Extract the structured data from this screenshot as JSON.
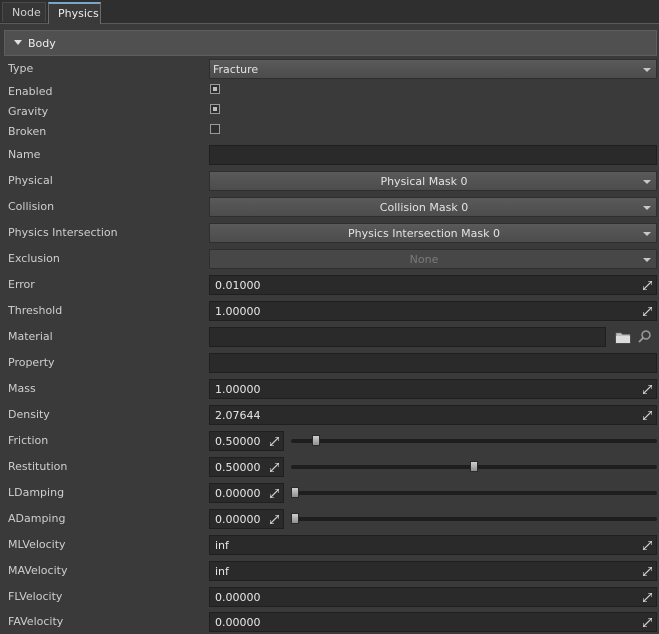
{
  "tabs": [
    {
      "label": "Node",
      "active": false
    },
    {
      "label": "Physics",
      "active": true
    }
  ],
  "section": {
    "title": "Body",
    "expanded": true
  },
  "rows": {
    "type": {
      "label": "Type",
      "value": "Fracture"
    },
    "enabled": {
      "label": "Enabled",
      "checked": true
    },
    "gravity": {
      "label": "Gravity",
      "checked": true
    },
    "broken": {
      "label": "Broken",
      "checked": false
    },
    "name": {
      "label": "Name",
      "value": ""
    },
    "physical": {
      "label": "Physical",
      "value": "Physical Mask 0"
    },
    "collision": {
      "label": "Collision",
      "value": "Collision Mask 0"
    },
    "physics_intersection": {
      "label": "Physics Intersection",
      "value": "Physics Intersection Mask 0"
    },
    "exclusion": {
      "label": "Exclusion",
      "value": "None"
    },
    "error": {
      "label": "Error",
      "value": "0.01000"
    },
    "threshold": {
      "label": "Threshold",
      "value": "1.00000"
    },
    "material": {
      "label": "Material",
      "value": ""
    },
    "property": {
      "label": "Property",
      "value": ""
    },
    "mass": {
      "label": "Mass",
      "value": "1.00000"
    },
    "density": {
      "label": "Density",
      "value": "2.07644"
    },
    "friction": {
      "label": "Friction",
      "value": "0.50000",
      "slider_fraction": 0.06
    },
    "restitution": {
      "label": "Restitution",
      "value": "0.50000",
      "slider_fraction": 0.5
    },
    "ldamping": {
      "label": "LDamping",
      "value": "0.00000",
      "slider_fraction": 0.0
    },
    "adamping": {
      "label": "ADamping",
      "value": "0.00000",
      "slider_fraction": 0.0
    },
    "mlvelocity": {
      "label": "MLVelocity",
      "value": "inf"
    },
    "mavelocity": {
      "label": "MAVelocity",
      "value": "inf"
    },
    "flvelocity": {
      "label": "FLVelocity",
      "value": "0.00000"
    },
    "favelocity": {
      "label": "FAVelocity",
      "value": "0.00000"
    }
  },
  "icons": {
    "folder": "folder-icon",
    "search": "search-icon",
    "expand": "expand-arrows-icon"
  }
}
